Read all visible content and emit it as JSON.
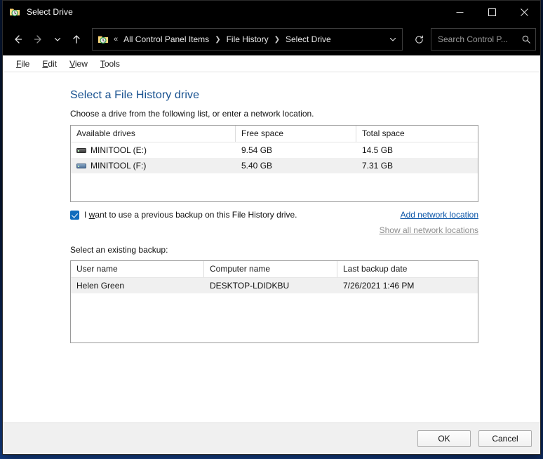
{
  "window": {
    "title": "Select Drive",
    "title_icon": "file-history-folder-icon",
    "controls": {
      "minimize": "—",
      "maximize": "□",
      "close": "✕"
    }
  },
  "toolbar": {
    "back_icon": "arrow-left-icon",
    "forward_icon": "arrow-right-icon",
    "recent_icon": "chevron-down-icon",
    "up_icon": "arrow-up-icon",
    "address": {
      "icon": "file-history-folder-icon",
      "overflow": "«",
      "crumbs": [
        "All Control Panel Items",
        "File History",
        "Select Drive"
      ],
      "separator": "❯",
      "dropdown_icon": "chevron-down-icon"
    },
    "refresh_icon": "refresh-icon",
    "search": {
      "placeholder": "Search Control P...",
      "icon": "search-icon"
    }
  },
  "menubar": {
    "items": [
      {
        "pre": "",
        "accel": "F",
        "post": "ile"
      },
      {
        "pre": "",
        "accel": "E",
        "post": "dit"
      },
      {
        "pre": "",
        "accel": "V",
        "post": "iew"
      },
      {
        "pre": "",
        "accel": "T",
        "post": "ools"
      }
    ]
  },
  "page": {
    "title": "Select a File History drive",
    "subtitle": "Choose a drive from the following list, or enter a network location."
  },
  "drives_table": {
    "columns": [
      "Available drives",
      "Free space",
      "Total space"
    ],
    "rows": [
      {
        "icon": "drive-icon",
        "icon_style": "gray",
        "name": "MINITOOL (E:)",
        "free_space": "9.54 GB",
        "total_space": "14.5 GB",
        "selected": false
      },
      {
        "icon": "drive-icon",
        "icon_style": "blue",
        "name": "MINITOOL (F:)",
        "free_space": "5.40 GB",
        "total_space": "7.31 GB",
        "selected": true
      }
    ]
  },
  "options": {
    "checkbox": {
      "checked": true,
      "pre": "I ",
      "accel": "w",
      "post": "ant to use a previous backup on this File History drive."
    },
    "add_network_location": {
      "accel": "A",
      "post": "dd network location",
      "enabled": true
    },
    "show_all_network_locations": {
      "accel": "S",
      "post": "how all network locations",
      "enabled": false
    }
  },
  "backup_section": {
    "label": "Select an existing backup:",
    "columns": [
      "User name",
      "Computer name",
      "Last backup date"
    ],
    "rows": [
      {
        "user_name": "Helen Green",
        "computer_name": "DESKTOP-LDIDKBU",
        "last_backup_date": "7/26/2021 1:46 PM",
        "selected": true
      }
    ]
  },
  "footer": {
    "ok_label": "OK",
    "cancel_label": "Cancel"
  },
  "colors": {
    "title_accent": "#16508f",
    "link": "#0a55a8",
    "link_disabled": "#8d8d8d",
    "checkbox": "#0f6cbd",
    "selection_row": "#f0f0f0",
    "titlebar_bg": "#000000",
    "desktop": "#123c84"
  }
}
